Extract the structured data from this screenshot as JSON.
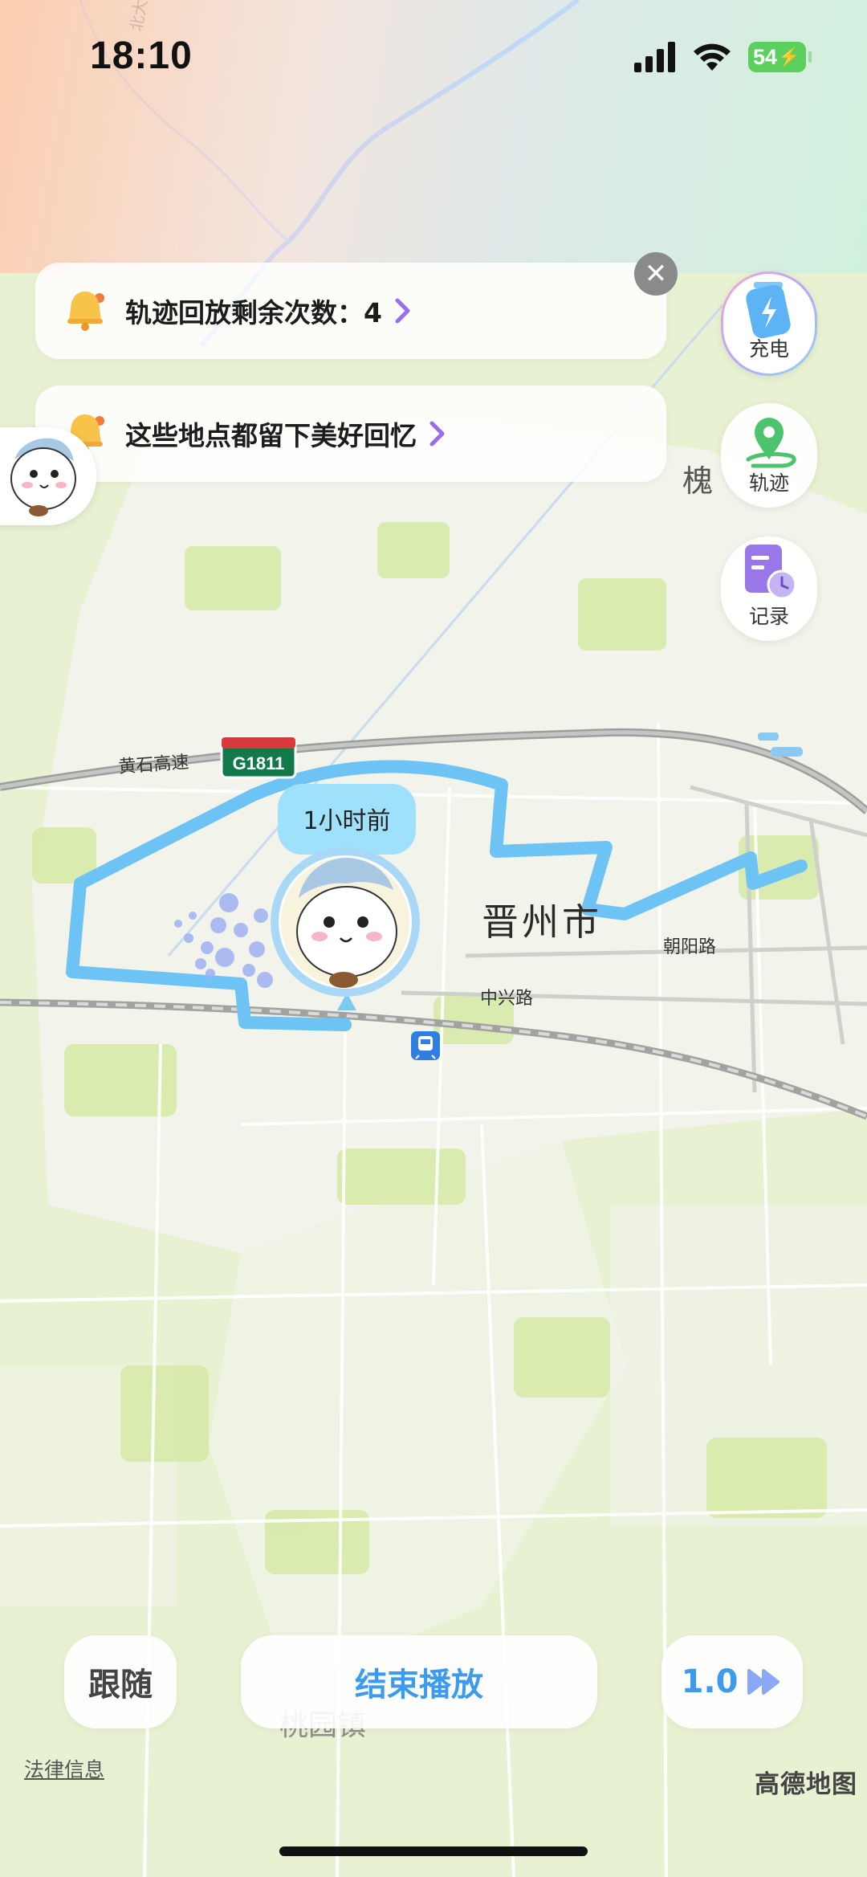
{
  "status_bar": {
    "time": "18:10",
    "battery": "54"
  },
  "notices": [
    {
      "text": "轨迹回放剩余次数：4"
    },
    {
      "text": "这些地点都留下美好回忆"
    }
  ],
  "side_buttons": [
    {
      "label": "充电",
      "icon": "battery-charge-icon"
    },
    {
      "label": "轨迹",
      "icon": "location-track-icon"
    },
    {
      "label": "记录",
      "icon": "record-clock-icon"
    }
  ],
  "map": {
    "city": "晋州市",
    "city_partial": "槐",
    "roads": [
      "黄石高速",
      "朝阳路",
      "中兴路",
      "北大道"
    ],
    "highway_shield": "G1811",
    "town": "桃园镇",
    "time_bubble": "1小时前"
  },
  "controls": {
    "follow": "跟随",
    "end": "结束播放",
    "speed": "1.0"
  },
  "footer": {
    "legal": "法律信息",
    "logo": "高德地图"
  },
  "colors": {
    "track": "#6ec3f5",
    "accent": "#3d9bef",
    "chevron": "#9b6bf0",
    "map_bg": "#e9f2d4"
  }
}
